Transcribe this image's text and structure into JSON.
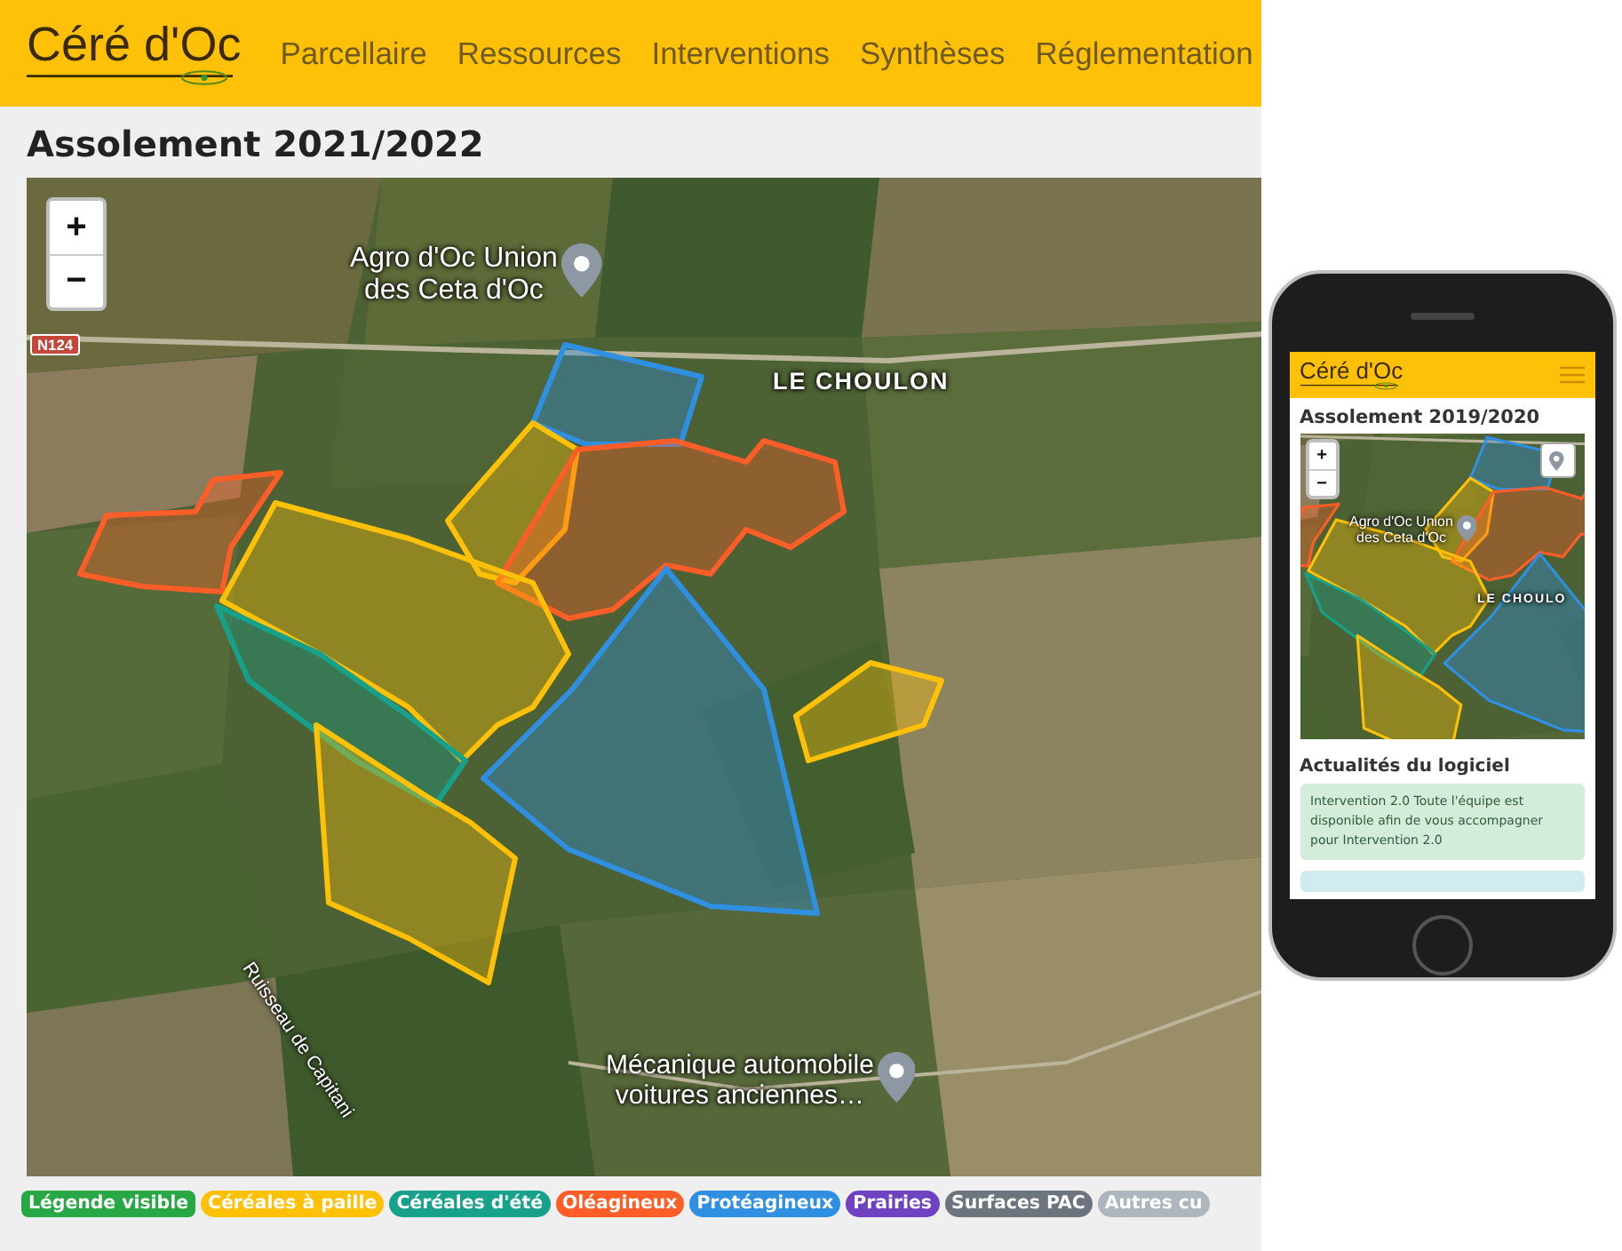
{
  "header": {
    "logo": "Céré d'Oc",
    "nav": [
      "Parcellaire",
      "Ressources",
      "Interventions",
      "Synthèses",
      "Réglementation"
    ]
  },
  "page_title": "Assolement 2021/2022",
  "map": {
    "zoom_in": "+",
    "zoom_out": "−",
    "places": [
      {
        "kind": "poi",
        "lines": [
          "Agro d'Oc Union",
          "des Ceta d'Oc"
        ]
      },
      {
        "kind": "locality",
        "lines": [
          "LE CHOULON"
        ]
      },
      {
        "kind": "road",
        "lines": [
          "N124"
        ]
      },
      {
        "kind": "poi",
        "lines": [
          "Mécanique automobile",
          "voitures anciennes…"
        ]
      },
      {
        "kind": "river",
        "lines": [
          "Ruisseau de Capitani"
        ]
      }
    ]
  },
  "legend": [
    {
      "label": "Légende visible",
      "color": "#28a745"
    },
    {
      "label": "Céréales à paille",
      "color": "#ffc107"
    },
    {
      "label": "Céréales d'été",
      "color": "#17a08a"
    },
    {
      "label": "Oléagineux",
      "color": "#fd5e28"
    },
    {
      "label": "Protéagineux",
      "color": "#2f8fe0"
    },
    {
      "label": "Prairies",
      "color": "#6f42c1"
    },
    {
      "label": "Surfaces PAC",
      "color": "#6c757d"
    },
    {
      "label": "Autres cu",
      "color": "#adb5bd"
    }
  ],
  "phone": {
    "logo": "Céré d'Oc",
    "title": "Assolement 2019/2020",
    "zoom_in": "+",
    "zoom_out": "−",
    "places": [
      {
        "kind": "poi",
        "lines": [
          "Agro d'Oc Union",
          "des Ceta d'Oc"
        ]
      },
      {
        "kind": "locality",
        "lines": [
          "LE CHOULO"
        ]
      }
    ],
    "news_title": "Actualités du logiciel",
    "news": [
      "Intervention 2.0 Toute l'équipe est disponible afin de vous accompagner pour Intervention 2.0"
    ]
  }
}
